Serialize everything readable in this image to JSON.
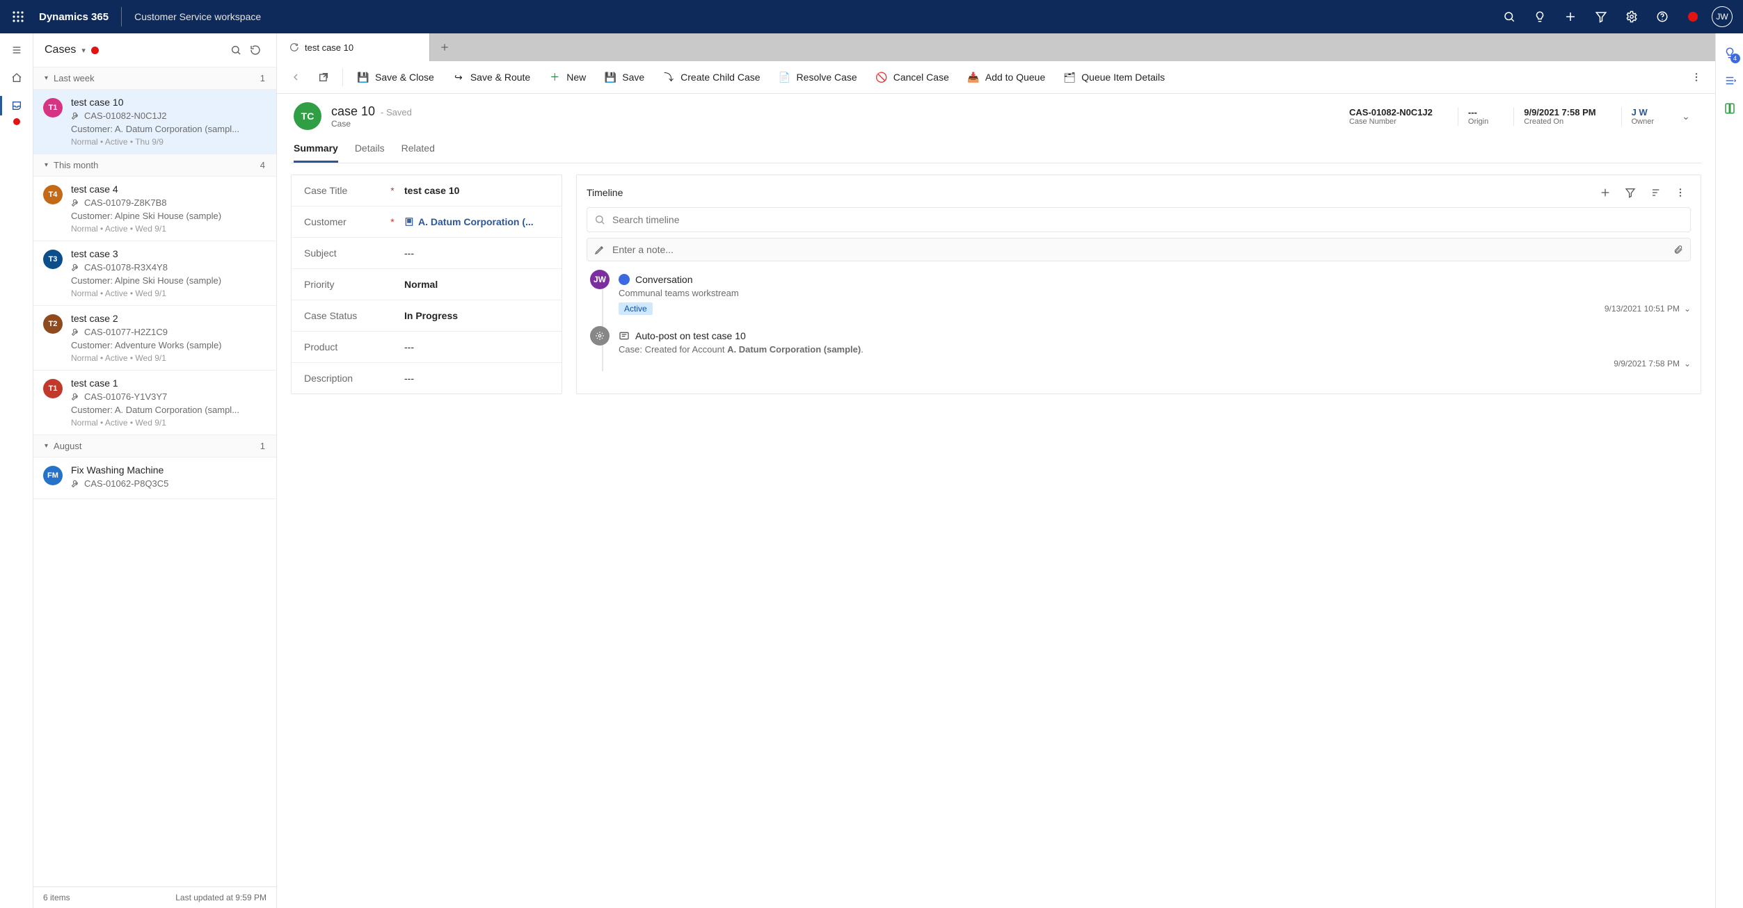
{
  "topnav": {
    "brand": "Dynamics 365",
    "app_name": "Customer Service workspace",
    "user_initials": "JW"
  },
  "cases_panel": {
    "title": "Cases",
    "footer_count": "6 items",
    "footer_updated": "Last updated at 9:59 PM",
    "groups": [
      {
        "label": "Last week",
        "count": "1",
        "items": [
          {
            "avatar_text": "T1",
            "avatar_color": "#d63384",
            "title": "test case 10",
            "case_number": "CAS-01082-N0C1J2",
            "customer": "Customer: A. Datum Corporation (sampl...",
            "meta": "Normal  •  Active  •  Thu 9/9",
            "selected": true
          }
        ]
      },
      {
        "label": "This month",
        "count": "4",
        "items": [
          {
            "avatar_text": "T4",
            "avatar_color": "#c26a17",
            "title": "test case 4",
            "case_number": "CAS-01079-Z8K7B8",
            "customer": "Customer: Alpine Ski House (sample)",
            "meta": "Normal  •  Active  •  Wed 9/1",
            "selected": false
          },
          {
            "avatar_text": "T3",
            "avatar_color": "#0b4e8a",
            "title": "test case 3",
            "case_number": "CAS-01078-R3X4Y8",
            "customer": "Customer: Alpine Ski House (sample)",
            "meta": "Normal  •  Active  •  Wed 9/1",
            "selected": false
          },
          {
            "avatar_text": "T2",
            "avatar_color": "#8f4a1d",
            "title": "test case 2",
            "case_number": "CAS-01077-H2Z1C9",
            "customer": "Customer: Adventure Works (sample)",
            "meta": "Normal  •  Active  •  Wed 9/1",
            "selected": false
          },
          {
            "avatar_text": "T1",
            "avatar_color": "#c0392b",
            "title": "test case 1",
            "case_number": "CAS-01076-Y1V3Y7",
            "customer": "Customer: A. Datum Corporation (sampl...",
            "meta": "Normal  •  Active  •  Wed 9/1",
            "selected": false
          }
        ]
      },
      {
        "label": "August",
        "count": "1",
        "items": [
          {
            "avatar_text": "FM",
            "avatar_color": "#2672c8",
            "title": "Fix Washing Machine",
            "case_number": "CAS-01062-P8Q3C5",
            "customer": "",
            "meta": "",
            "selected": false
          }
        ]
      }
    ]
  },
  "tab": {
    "active_label": "test case 10"
  },
  "cmdbar": {
    "save_close": "Save & Close",
    "save_route": "Save & Route",
    "new": "New",
    "save": "Save",
    "create_child": "Create Child Case",
    "resolve": "Resolve Case",
    "cancel": "Cancel Case",
    "add_queue": "Add to Queue",
    "queue_details": "Queue Item Details"
  },
  "record": {
    "avatar_initials": "TC",
    "title": "case 10",
    "saved_label": "- Saved",
    "entity": "Case",
    "stats": {
      "case_number": {
        "value": "CAS-01082-N0C1J2",
        "label": "Case Number"
      },
      "origin": {
        "value": "---",
        "label": "Origin"
      },
      "created_on": {
        "value": "9/9/2021 7:58 PM",
        "label": "Created On"
      },
      "owner": {
        "value": "J W",
        "label": "Owner"
      }
    },
    "form_tabs": {
      "summary": "Summary",
      "details": "Details",
      "related": "Related"
    },
    "fields": {
      "case_title": {
        "label": "Case Title",
        "required": true,
        "value": "test case 10"
      },
      "customer": {
        "label": "Customer",
        "required": true,
        "value": "A. Datum Corporation (..."
      },
      "subject": {
        "label": "Subject",
        "required": false,
        "value": "---"
      },
      "priority": {
        "label": "Priority",
        "required": false,
        "value": "Normal"
      },
      "case_status": {
        "label": "Case Status",
        "required": false,
        "value": "In Progress"
      },
      "product": {
        "label": "Product",
        "required": false,
        "value": "---"
      },
      "description": {
        "label": "Description",
        "required": false,
        "value": "---"
      }
    }
  },
  "timeline": {
    "title": "Timeline",
    "search_placeholder": "Search timeline",
    "note_placeholder": "Enter a note...",
    "items": [
      {
        "dot_type": "jw",
        "dot_text": "JW",
        "chip": true,
        "title": "Conversation",
        "subtitle": "Communal teams workstream",
        "badge": "Active",
        "timestamp": "9/13/2021 10:51 PM"
      },
      {
        "dot_type": "sys",
        "dot_text": "",
        "chip": false,
        "title": "Auto-post on test case 10",
        "subtitle_html": "Case: Created for Account <b>A. Datum Corporation (sample)</b>.",
        "badge": "",
        "timestamp": "9/9/2021 7:58 PM"
      }
    ]
  },
  "right_rail": {
    "smart_assist_badge": "4"
  }
}
